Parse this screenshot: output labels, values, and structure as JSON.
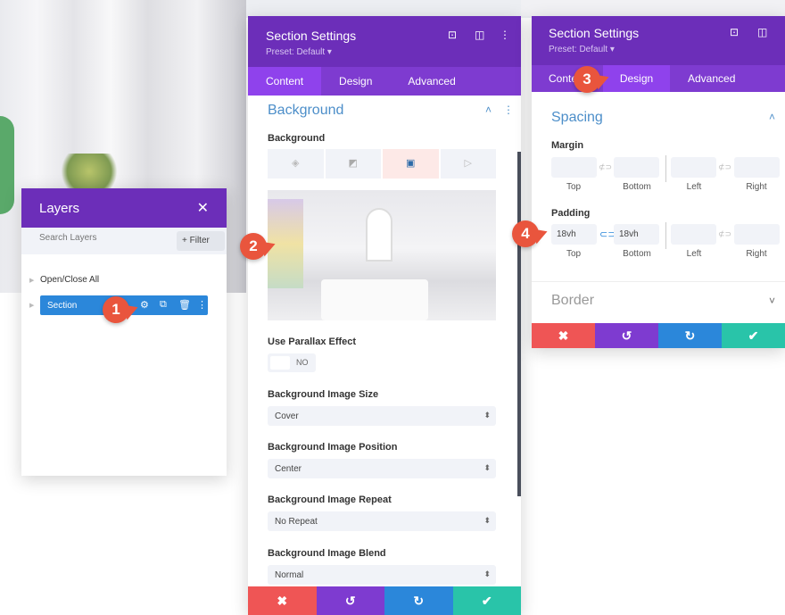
{
  "colors": {
    "purple_dark": "#6c2eb9",
    "purple_tab": "#7e3bd0",
    "blue": "#2b87da",
    "red": "#ef5555",
    "green": "#29c4a9",
    "marker": "#e9553d"
  },
  "layers": {
    "title": "Layers",
    "search_placeholder": "Search Layers",
    "filter_label": "+ Filter",
    "open_close_all": "Open/Close All",
    "section_label": "Section"
  },
  "content_panel": {
    "title": "Section Settings",
    "preset": "Preset: Default ▾",
    "tabs": [
      "Content",
      "Design",
      "Advanced"
    ],
    "active_tab": "Content",
    "section_title": "Background",
    "bg_label": "Background",
    "bg_types": [
      "color",
      "gradient",
      "image",
      "video"
    ],
    "active_bg_type": "image",
    "parallax_label": "Use Parallax Effect",
    "parallax_value": "NO",
    "fields": [
      {
        "label": "Background Image Size",
        "value": "Cover"
      },
      {
        "label": "Background Image Position",
        "value": "Center"
      },
      {
        "label": "Background Image Repeat",
        "value": "No Repeat"
      },
      {
        "label": "Background Image Blend",
        "value": "Normal"
      }
    ]
  },
  "design_panel": {
    "title": "Section Settings",
    "preset": "Preset: Default ▾",
    "tabs": [
      "Content",
      "Design",
      "Advanced"
    ],
    "active_tab": "Design",
    "section_title": "Spacing",
    "margin_label": "Margin",
    "padding_label": "Padding",
    "sides": [
      "Top",
      "Bottom",
      "Left",
      "Right"
    ],
    "padding_top": "18vh",
    "padding_bottom": "18vh",
    "border_title": "Border"
  },
  "markers": [
    "1",
    "2",
    "3",
    "4"
  ],
  "actions": {
    "cancel": "✖",
    "undo": "↺",
    "redo": "↻",
    "save": "✔"
  }
}
